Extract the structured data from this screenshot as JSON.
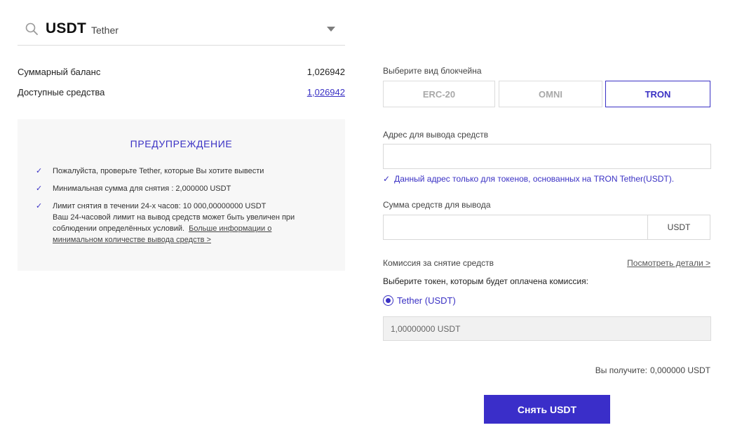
{
  "coin": {
    "symbol": "USDT",
    "name": "Tether"
  },
  "balance": {
    "total_label": "Суммарный баланс",
    "total_value": "1,026942",
    "available_label": "Доступные средства",
    "available_value": "1,026942"
  },
  "warning": {
    "title": "ПРЕДУПРЕЖДЕНИЕ",
    "items": [
      "Пожалуйста, проверьте Tether, которые Вы хотите вывести",
      "Минимальная сумма для снятия : 2,000000 USDT",
      "Лимит снятия в течении 24-х часов: 10 000,00000000 USDT"
    ],
    "item3_line2": "Ваш 24-часовой лимит на вывод средств может быть увеличен при соблюдении определённых условий.",
    "more_link": "Больше информации о минимальном количестве вывода средств >"
  },
  "chain": {
    "label": "Выберите вид блокчейна",
    "options": [
      "ERC-20",
      "OMNI",
      "TRON"
    ],
    "selected": "TRON"
  },
  "address": {
    "label": "Адрес для вывода средств",
    "value": "",
    "note": "Данный адрес только для токенов, основанных на TRON Tether(USDT)."
  },
  "amount": {
    "label": "Сумма средств для вывода",
    "value": "",
    "unit": "USDT"
  },
  "fee": {
    "label": "Комиссия за снятие средств",
    "details_link": "Посмотреть детали >",
    "choose_label": "Выберите токен, которым будет оплачена комиссия:",
    "token_option": "Tether (USDT)",
    "value": "1,00000000 USDT"
  },
  "receive": {
    "label": "Вы получите:",
    "value": "0,000000 USDT"
  },
  "submit_label": "Снять USDT",
  "colors": {
    "accent": "#3a31c4",
    "button": "#3a2ec9"
  }
}
